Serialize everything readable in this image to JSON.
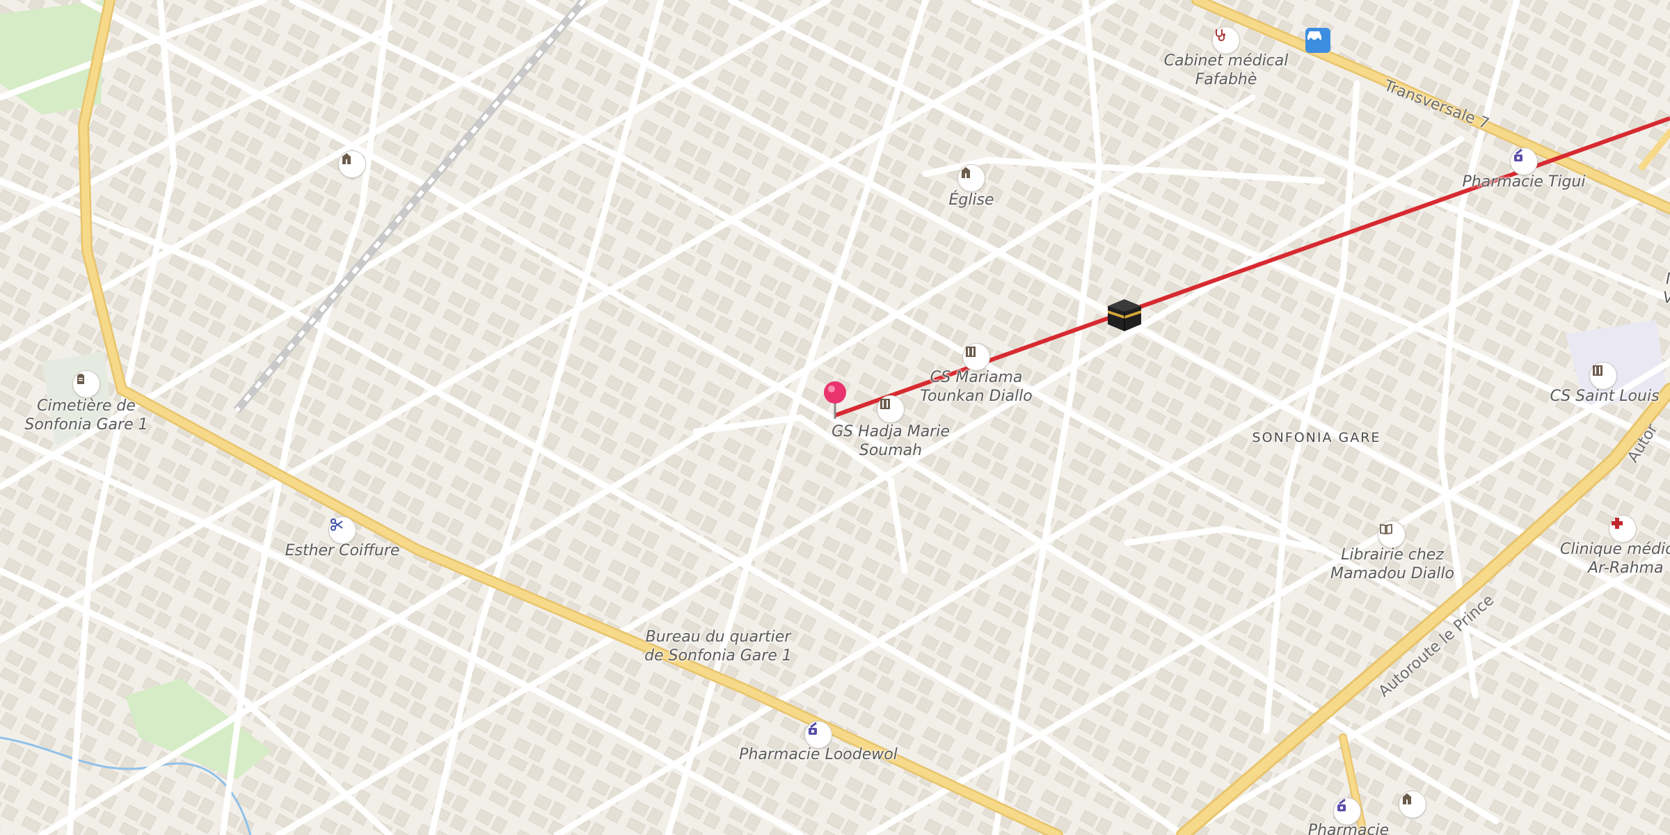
{
  "map": {
    "district": "SONFONIA GARE",
    "roads": {
      "transversale": "Transversale 7",
      "autoroute": "Autoroute le Prince",
      "autoroute_edge": "Autor"
    },
    "pois": [
      {
        "id": "cabinet",
        "line1": "Cabinet médical",
        "line2": "Fafabhè",
        "icon": "stethoscope-icon"
      },
      {
        "id": "eglise",
        "line1": "Église",
        "line2": "",
        "icon": "church-icon"
      },
      {
        "id": "pharmacie-tigui",
        "line1": "Pharmacie Tigui",
        "line2": "",
        "icon": "pharmacy-icon"
      },
      {
        "id": "cs-mariama",
        "line1": "CS Mariama",
        "line2": "Tounkan Diallo",
        "icon": "school-icon"
      },
      {
        "id": "gs-hadja",
        "line1": "GS Hadja Marie",
        "line2": "Soumah",
        "icon": "school-icon"
      },
      {
        "id": "cs-saint-louis",
        "line1": "CS Saint Louis",
        "line2": "",
        "icon": "school-icon"
      },
      {
        "id": "cimetiere",
        "line1": "Cimetière de",
        "line2": "Sonfonia Gare 1",
        "icon": "cemetery-icon"
      },
      {
        "id": "esther",
        "line1": "Esther Coiffure",
        "line2": "",
        "icon": "scissors-icon"
      },
      {
        "id": "librairie",
        "line1": "Librairie chez",
        "line2": "Mamadou Diallo",
        "icon": "book-icon"
      },
      {
        "id": "clinique",
        "line1": "Clinique médica",
        "line2": "Ar-Rahma",
        "icon": "medical-cross-icon"
      },
      {
        "id": "bureau",
        "line1": "Bureau du quartier",
        "line2": "de Sonfonia Gare 1",
        "icon": ""
      },
      {
        "id": "pharmacie-loodewol",
        "line1": "Pharmacie Loodewol",
        "line2": "",
        "icon": "pharmacy-icon"
      },
      {
        "id": "pharmacie-bottom",
        "line1": "Pharmacie",
        "line2": "",
        "icon": "pharmacy-icon"
      },
      {
        "id": "nb-edge",
        "line1": "NB",
        "line2": "VIS",
        "icon": ""
      }
    ],
    "qibla_marker_icon": "kaaba-icon",
    "location_pin_icon": "map-pin-icon",
    "colors": {
      "background": "#f2efe9",
      "major_road": "#f7d98a",
      "qibla_line": "#d72a30",
      "pin": "#e8336f",
      "park": "#d6ecc6"
    }
  }
}
